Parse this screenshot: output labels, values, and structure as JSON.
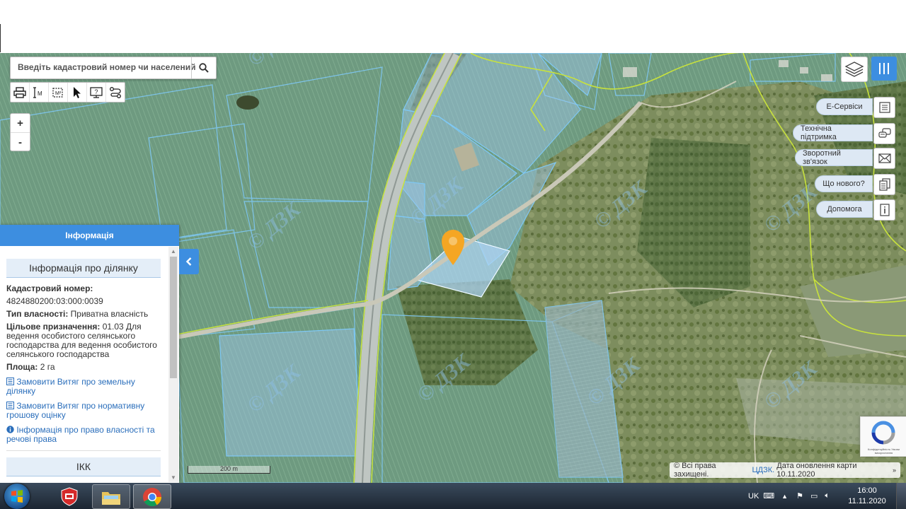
{
  "search": {
    "placeholder": "Введіть кадастровий номер чи населений"
  },
  "zoom": {
    "in_label": "+",
    "out_label": "-"
  },
  "info_panel": {
    "title": "Інформація",
    "section_title": "Інформація про ділянку",
    "cadastral_label": "Кадастровий номер:",
    "cadastral_value": "4824880200:03:000:0039",
    "ownership_label": "Тип власності:",
    "ownership_value": "Приватна власність",
    "purpose_label": "Цільове призначення:",
    "purpose_value": "01.03 Для ведення особистого селянського господарства для ведення особистого селянського господарства",
    "area_label": "Площа:",
    "area_value": "2 га",
    "links": [
      "Замовити Витяг про земельну ділянку",
      "Замовити Витяг про нормативну грошову оцінку",
      "Інформація про право власності та речові права"
    ],
    "ikk_title": "ІКК"
  },
  "services": [
    {
      "label": "Е-Сервіси",
      "icon": "document-list-icon"
    },
    {
      "label": "Технічна підтримка",
      "icon": "support-chat-icon"
    },
    {
      "label": "Зворотний зв'язок",
      "icon": "envelope-icon"
    },
    {
      "label": "Що нового?",
      "icon": "documents-icon"
    },
    {
      "label": "Допомога",
      "icon": "info-icon"
    }
  ],
  "scale": {
    "label": "200 m"
  },
  "footer": {
    "copyright_text": "© Всі права захищені.",
    "org_link": "ЦДЗК.",
    "update_text": "Дата оновлення карти 10.11.2020",
    "more": "»"
  },
  "recaptcha": {
    "text": "Конфіденційність Умови використання"
  },
  "watermark": {
    "text": "© ДЗК"
  },
  "taskbar": {
    "language": "UK",
    "time": "16:00",
    "date": "11.11.2020"
  },
  "colors": {
    "accent": "#3d8ee0",
    "marker": "#f5a623",
    "parcel_border": "#7ec8f5",
    "boundary_line": "#c8e23c"
  }
}
